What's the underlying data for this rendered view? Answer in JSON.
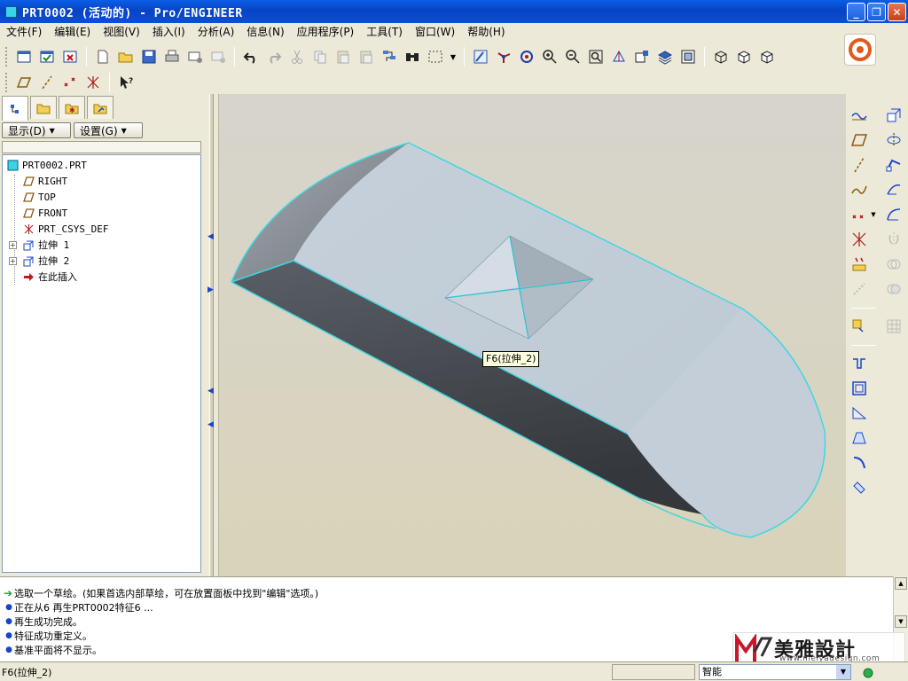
{
  "window": {
    "title": "PRT0002 (活动的) - Pro/ENGINEER",
    "minimize": "_",
    "restore": "❐",
    "close": "✕"
  },
  "menubar": {
    "items": [
      "文件(F)",
      "编辑(E)",
      "视图(V)",
      "插入(I)",
      "分析(A)",
      "信息(N)",
      "应用程序(P)",
      "工具(T)",
      "窗口(W)",
      "帮助(H)"
    ]
  },
  "nav": {
    "display_button": "显示(D)",
    "settings_button": "设置(G)",
    "tree": [
      {
        "label": "PRT0002.PRT",
        "icon": "part-icon"
      },
      {
        "label": "RIGHT",
        "icon": "datum-plane-icon"
      },
      {
        "label": "TOP",
        "icon": "datum-plane-icon"
      },
      {
        "label": "FRONT",
        "icon": "datum-plane-icon"
      },
      {
        "label": "PRT_CSYS_DEF",
        "icon": "csys-icon"
      },
      {
        "label": "拉伸 1",
        "icon": "extrude-icon"
      },
      {
        "label": "拉伸 2",
        "icon": "extrude-icon"
      },
      {
        "label": "在此插入",
        "icon": "insert-here-arrow-icon"
      }
    ]
  },
  "viewport": {
    "tooltip": "F6(拉伸_2)",
    "colors": {
      "model_top": "#c3cfd8",
      "model_side_dark": "#3e4247",
      "edge_highlight": "#3fd7e2",
      "background_top": "#d6d4cc",
      "background_bottom": "#d9d3b9"
    }
  },
  "messages": [
    {
      "type": "prompt",
      "text": "选取一个草绘。(如果首选内部草绘，可在放置面板中找到\"编辑\"选项。)"
    },
    {
      "type": "info",
      "text": "正在从6 再生PRT0002特征6 ..."
    },
    {
      "type": "info",
      "text": "再生成功完成。"
    },
    {
      "type": "info",
      "text": "特征成功重定义。"
    },
    {
      "type": "info",
      "text": "基准平面将不显示。"
    }
  ],
  "statusbar": {
    "text": "F6(拉伸_2)",
    "filter": "智能"
  },
  "watermark": {
    "brand": "美雅設計",
    "url": "www.meiyadesign.com"
  }
}
